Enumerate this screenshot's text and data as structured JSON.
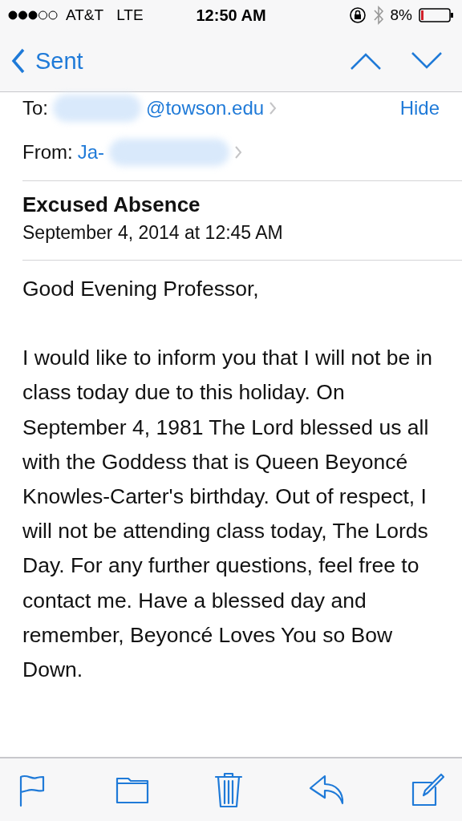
{
  "status_bar": {
    "carrier": "AT&T",
    "network": "LTE",
    "time": "12:50 AM",
    "battery": "8%"
  },
  "nav": {
    "back": "Sent"
  },
  "header": {
    "to_label": "To:",
    "to_value": "@towson.edu",
    "hide": "Hide",
    "from_label": "From:",
    "from_value": "Ja-"
  },
  "message": {
    "subject": "Excused Absence",
    "date": "September 4, 2014 at 12:45 AM"
  },
  "body": [
    "Good Evening Professor,",
    "I would like to inform you that I will not be in class today due to this holiday. On September 4, 1981 The Lord blessed us all with the Goddess that is Queen Beyoncé Knowles-Carter's birthday. Out of respect, I will not be attending class today, The Lords Day.  For any further questions, feel free to contact me. Have a blessed day and remember, Beyoncé Loves You so Bow Down."
  ],
  "toolbar": [
    {
      "kind": "flag"
    },
    {
      "kind": "folder"
    },
    {
      "kind": "trash"
    },
    {
      "kind": "reply"
    },
    {
      "kind": "compose"
    }
  ]
}
